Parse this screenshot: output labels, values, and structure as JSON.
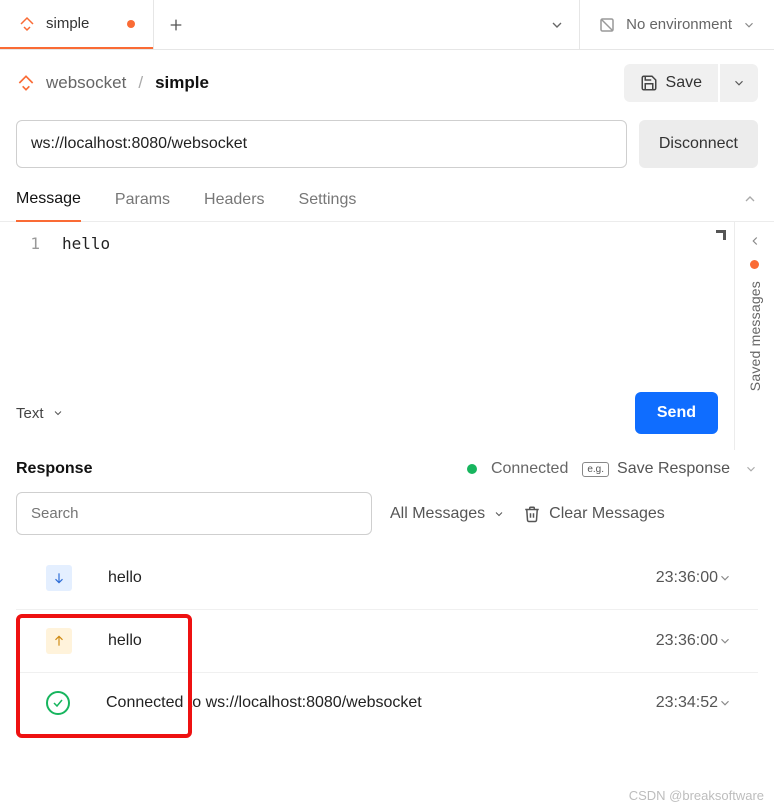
{
  "topbar": {
    "tab_label": "simple",
    "environment_label": "No environment"
  },
  "breadcrumb": {
    "parent": "websocket",
    "current": "simple"
  },
  "actions": {
    "save_label": "Save",
    "disconnect_label": "Disconnect"
  },
  "request": {
    "url": "ws://localhost:8080/websocket",
    "tabs": [
      "Message",
      "Params",
      "Headers",
      "Settings"
    ],
    "active_tab": "Message",
    "body_line_number": "1",
    "body_text": "hello",
    "format": "Text",
    "send_label": "Send"
  },
  "rail": {
    "saved_messages_label": "Saved messages"
  },
  "response": {
    "title": "Response",
    "status_text": "Connected",
    "save_response_label": "Save Response",
    "eg_badge": "e.g.",
    "search_placeholder": "Search",
    "filter_label": "All Messages",
    "clear_label": "Clear Messages",
    "messages": [
      {
        "direction": "in",
        "text": "hello",
        "time": "23:36:00"
      },
      {
        "direction": "out",
        "text": "hello",
        "time": "23:36:00"
      },
      {
        "direction": "connected",
        "text": "Connected to ws://localhost:8080/websocket",
        "time": "23:34:52"
      }
    ]
  },
  "watermark": "CSDN @breaksoftware"
}
